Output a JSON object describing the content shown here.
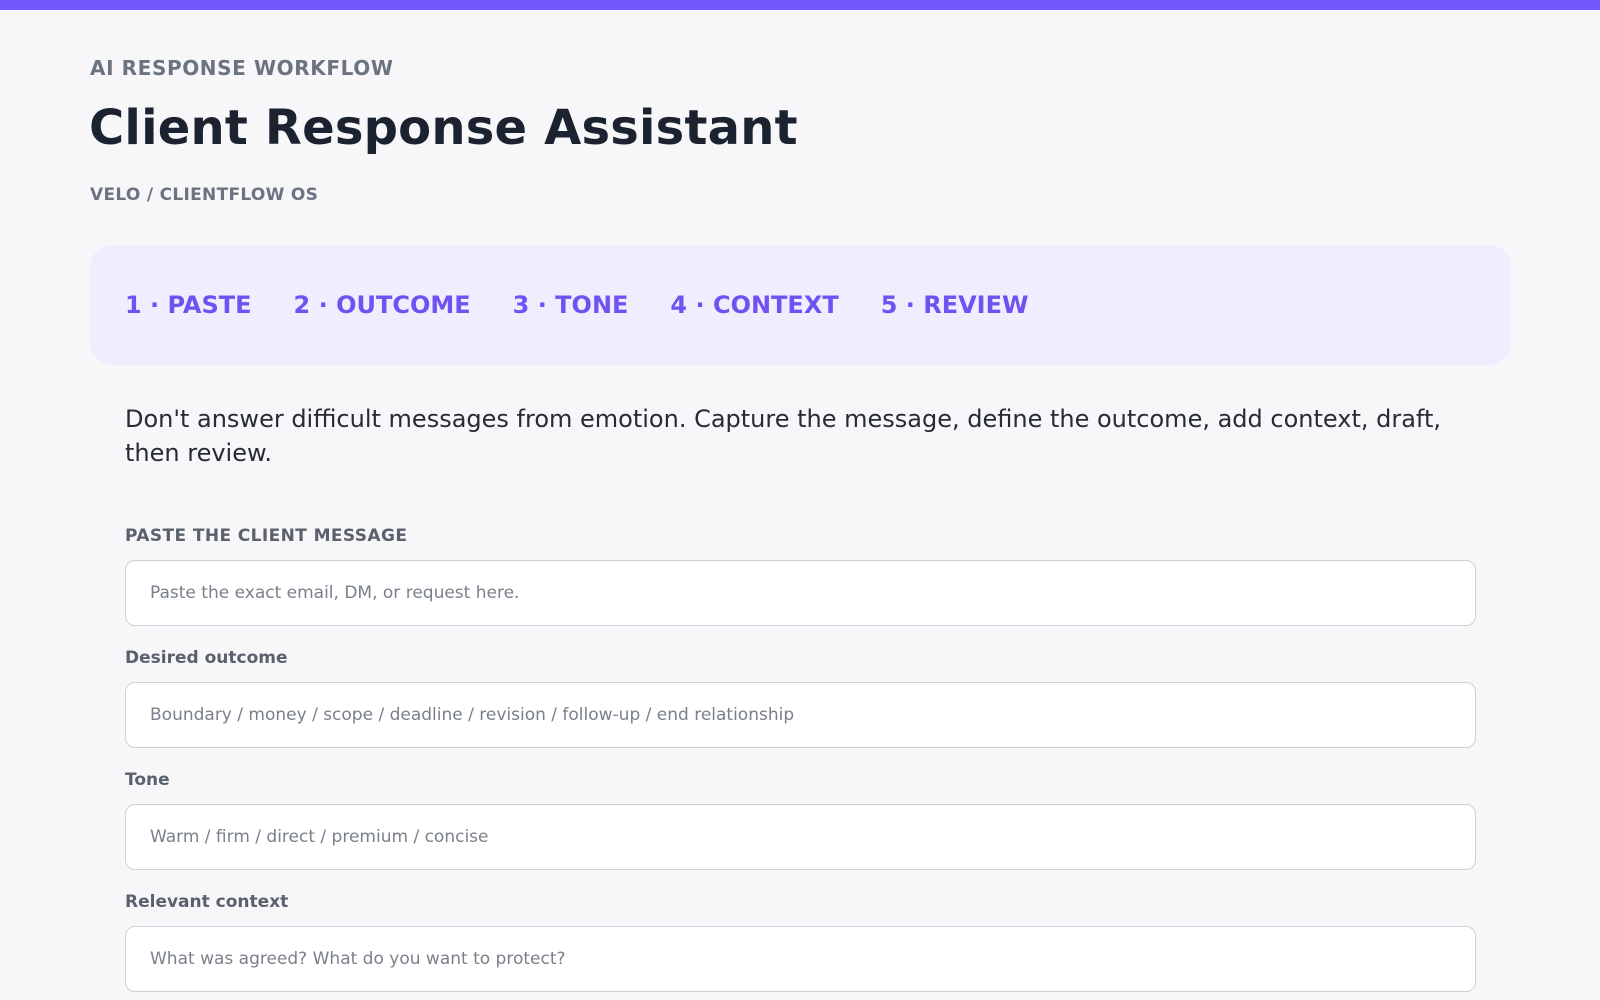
{
  "header": {
    "eyebrow": "AI RESPONSE WORKFLOW",
    "title": "Client Response Assistant",
    "subtitle": "VELO / CLIENTFLOW OS"
  },
  "steps": [
    {
      "label": "1 · PASTE"
    },
    {
      "label": "2 · OUTCOME"
    },
    {
      "label": "3 · TONE"
    },
    {
      "label": "4 · CONTEXT"
    },
    {
      "label": "5 · REVIEW"
    }
  ],
  "intro": "Don't answer difficult messages from emotion. Capture the message, define the outcome, add context, draft, then review.",
  "form": {
    "client_message": {
      "label": "PASTE THE CLIENT MESSAGE",
      "value": "",
      "placeholder": "Paste the exact email, DM, or request here."
    },
    "desired_outcome": {
      "label": "Desired outcome",
      "value": "",
      "placeholder": "Boundary / money / scope / deadline / revision / follow-up / end relationship"
    },
    "tone": {
      "label": "Tone",
      "value": "",
      "placeholder": "Warm / firm / direct / premium / concise"
    },
    "relevant_context": {
      "label": "Relevant context",
      "value": "",
      "placeholder": "What was agreed? What do you want to protect?"
    }
  },
  "colors": {
    "accent": "#7257fb",
    "step_text": "#7052f2",
    "step_bg": "#efedfe",
    "page_bg": "#f7f7f9"
  }
}
